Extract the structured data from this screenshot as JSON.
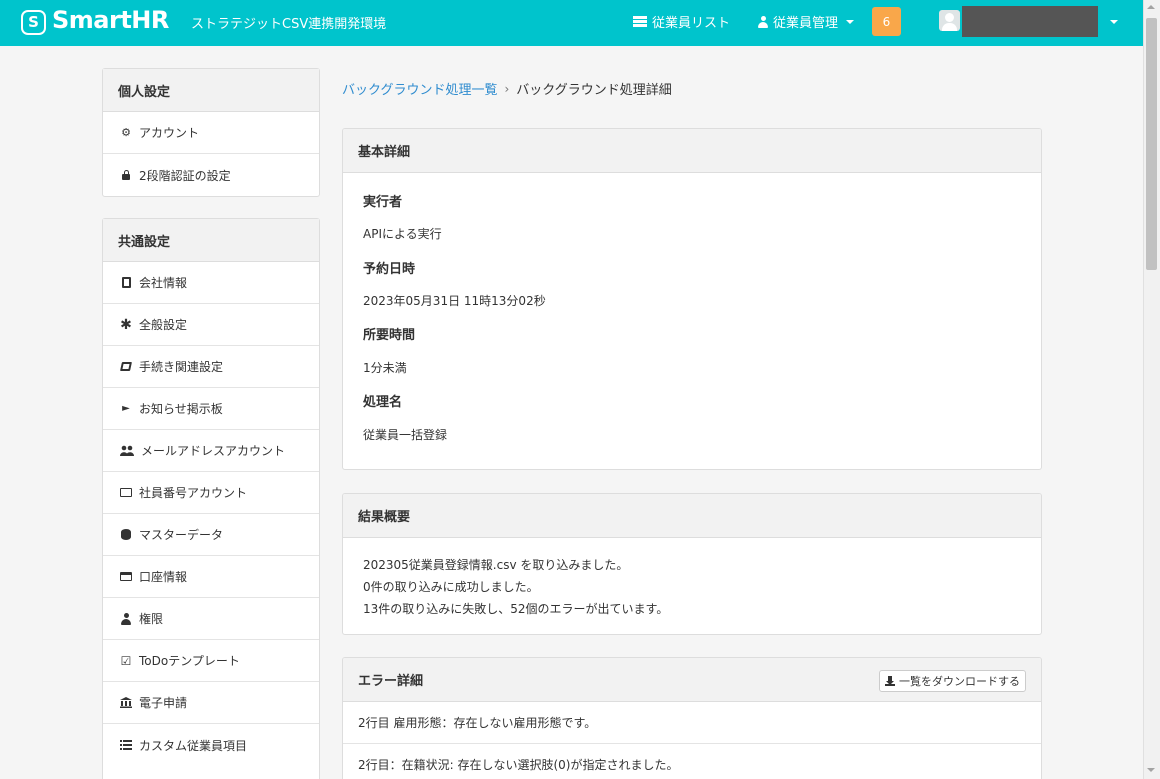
{
  "header": {
    "logo_mark": "S",
    "logo_text": "SmartHR",
    "environment": "ストラテジットCSV連携開発環境",
    "nav_employee_list": "従業員リスト",
    "nav_employee_manage": "従業員管理",
    "notification_count": "6"
  },
  "sidebar": {
    "personal": {
      "title": "個人設定",
      "items": [
        {
          "label": "アカウント",
          "icon": "gear-icon"
        },
        {
          "label": "2段階認証の設定",
          "icon": "lock-icon"
        }
      ]
    },
    "common": {
      "title": "共通設定",
      "items": [
        {
          "label": "会社情報",
          "icon": "building-icon"
        },
        {
          "label": "全般設定",
          "icon": "asterisk-icon"
        },
        {
          "label": "手続き関連設定",
          "icon": "book-icon"
        },
        {
          "label": "お知らせ掲示板",
          "icon": "megaphone-icon"
        },
        {
          "label": "メールアドレスアカウント",
          "icon": "users-icon"
        },
        {
          "label": "社員番号アカウント",
          "icon": "id-card-icon"
        },
        {
          "label": "マスターデータ",
          "icon": "database-icon"
        },
        {
          "label": "口座情報",
          "icon": "credit-card-icon"
        },
        {
          "label": "権限",
          "icon": "user-permission-icon"
        },
        {
          "label": "ToDoテンプレート",
          "icon": "checkbox-icon"
        },
        {
          "label": "電子申請",
          "icon": "bank-icon"
        },
        {
          "label": "カスタム従業員項目",
          "icon": "list-icon"
        }
      ]
    }
  },
  "breadcrumb": {
    "parent": "バックグラウンド処理一覧",
    "current": "バックグラウンド処理詳細"
  },
  "basic_details": {
    "title": "基本詳細",
    "fields": [
      {
        "label": "実行者",
        "value": "APIによる実行"
      },
      {
        "label": "予約日時",
        "value": "2023年05月31日 11時13分02秒"
      },
      {
        "label": "所要時間",
        "value": "1分未満"
      },
      {
        "label": "処理名",
        "value": "従業員一括登録"
      }
    ]
  },
  "result_summary": {
    "title": "結果概要",
    "lines": [
      "202305従業員登録情報.csv を取り込みました。",
      "0件の取り込みに成功しました。",
      "13件の取り込みに失敗し、52個のエラーが出ています。"
    ]
  },
  "error_details": {
    "title": "エラー詳細",
    "download_label": "一覧をダウンロードする",
    "rows": [
      "2行目 雇用形態：存在しない雇用形態です。",
      "2行目：在籍状況: 存在しない選択肢(0)が指定されました。"
    ]
  },
  "colors": {
    "header_bg": "#00c4cc",
    "link": "#2f8ccf",
    "badge": "#f9a74a"
  }
}
